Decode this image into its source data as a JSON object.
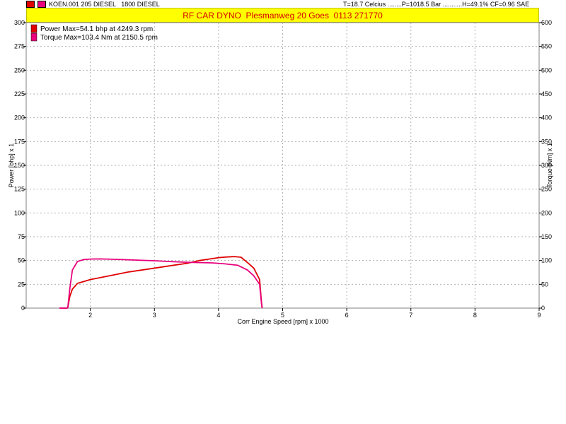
{
  "header": {
    "file_text": "KOEN.001 205 DIESEL   1800 DIESEL",
    "conditions_text": "T=18.7 Celcius ........P=1018.5 Bar ...........H=49.1% CF=0.96 SAE",
    "title": "RF CAR DYNO  Plesmanweg 20 Goes  0113 271770"
  },
  "colors": {
    "power": "#e00000",
    "torque": "#e8007c",
    "title_band": "#ffff00",
    "title_text": "#d40000",
    "grid": "#b0b0b0"
  },
  "chart_data": {
    "type": "line",
    "title": "RF CAR DYNO  Plesmanweg 20 Goes  0113 271770",
    "xlabel": "Corr Engine Speed [rpm] x 1000",
    "ylabel_left": "Power [bhp]  x 1",
    "ylabel_right": "Torque [Nm]  x 1",
    "xlim": [
      1,
      9
    ],
    "ylim_left": [
      0,
      300
    ],
    "ylim_right": [
      0,
      600
    ],
    "x_ticks": [
      2,
      3,
      4,
      5,
      6,
      7,
      8,
      9
    ],
    "y_left_ticks": [
      0,
      25,
      50,
      75,
      100,
      125,
      150,
      175,
      200,
      225,
      250,
      275,
      300
    ],
    "y_right_ticks": [
      0,
      50,
      100,
      150,
      200,
      250,
      300,
      350,
      400,
      450,
      500,
      550,
      600
    ],
    "grid": true,
    "legend_position": "top-left",
    "series": [
      {
        "name": "Power  Max=54.1 bhp at 4249.3 rpm",
        "axis": "left",
        "color": "#e00000",
        "x": [
          1.52,
          1.64,
          1.65,
          1.68,
          1.72,
          1.8,
          2.0,
          2.3,
          2.6,
          2.9,
          3.2,
          3.5,
          3.7,
          3.9,
          4.0,
          4.1,
          4.2,
          4.25,
          4.35,
          4.45,
          4.55,
          4.64,
          4.67,
          4.68
        ],
        "y": [
          0,
          0,
          1,
          12,
          20,
          26,
          30,
          34,
          38,
          41,
          44,
          47,
          50,
          52,
          53,
          53.6,
          54,
          54.1,
          53.5,
          48,
          42,
          30,
          6,
          0
        ]
      },
      {
        "name": "Torque  Max=103.4 Nm at 2150.5 rpm",
        "axis": "right",
        "color": "#e8007c",
        "x": [
          1.52,
          1.64,
          1.65,
          1.68,
          1.72,
          1.8,
          1.9,
          2.0,
          2.15,
          2.4,
          2.7,
          3.0,
          3.3,
          3.6,
          3.9,
          4.1,
          4.3,
          4.45,
          4.55,
          4.64,
          4.67,
          4.68
        ],
        "y": [
          0,
          0,
          2,
          40,
          80,
          98,
          102,
          103,
          103.4,
          102.5,
          101,
          99.5,
          97.5,
          96,
          95,
          93,
          90,
          80,
          68,
          50,
          10,
          0
        ]
      }
    ]
  }
}
